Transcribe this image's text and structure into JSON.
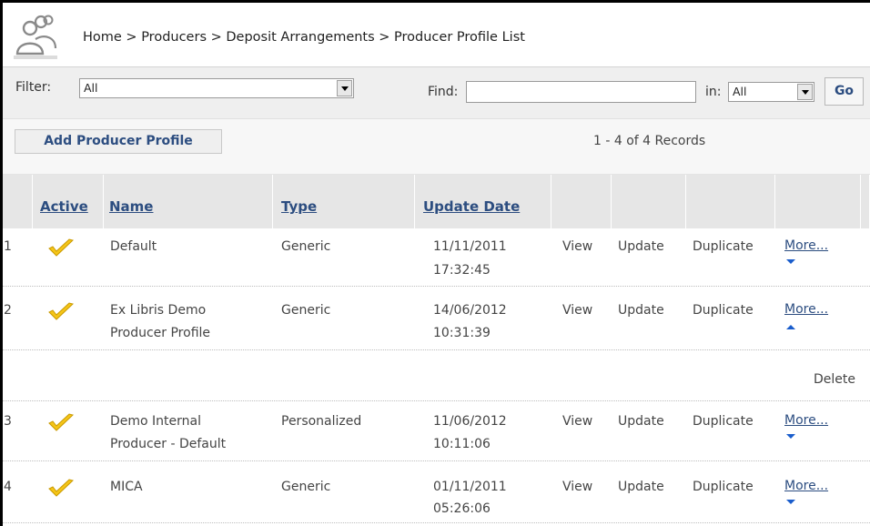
{
  "breadcrumb": "Home > Producers > Deposit Arrangements > Producer Profile List",
  "filter": {
    "label": "Filter:",
    "value": "All"
  },
  "find": {
    "label": "Find:",
    "value": "",
    "in_label": "in:",
    "in_value": "All",
    "go_label": "Go"
  },
  "actions": {
    "add_label": "Add Producer Profile",
    "records_text": "1 - 4 of 4 Records"
  },
  "table": {
    "headers": {
      "active": "Active",
      "name": "Name",
      "type": "Type",
      "update_date": "Update Date"
    },
    "row_actions": {
      "view": "View",
      "update": "Update",
      "duplicate": "Duplicate",
      "more": "More..."
    },
    "rows": [
      {
        "num": "1",
        "name_line1": "Default",
        "name_line2": "",
        "type": "Generic",
        "date": "11/11/2011",
        "time": "17:32:45"
      },
      {
        "num": "2",
        "name_line1": "Ex Libris Demo",
        "name_line2": "Producer Profile",
        "type": "Generic",
        "date": "14/06/2012",
        "time": "10:31:39"
      },
      {
        "num": "3",
        "name_line1": "Demo Internal",
        "name_line2": "Producer - Default",
        "type": "Personalized",
        "date": "11/06/2012",
        "time": "10:11:06"
      },
      {
        "num": "4",
        "name_line1": "MICA",
        "name_line2": "",
        "type": "Generic",
        "date": "01/11/2011",
        "time": "05:26:06"
      }
    ],
    "expanded_action": "Delete"
  },
  "colors": {
    "link": "#2c4d80",
    "header_bg": "#e6e6e6",
    "filter_bg": "#efefef",
    "check": "#f5c518"
  }
}
